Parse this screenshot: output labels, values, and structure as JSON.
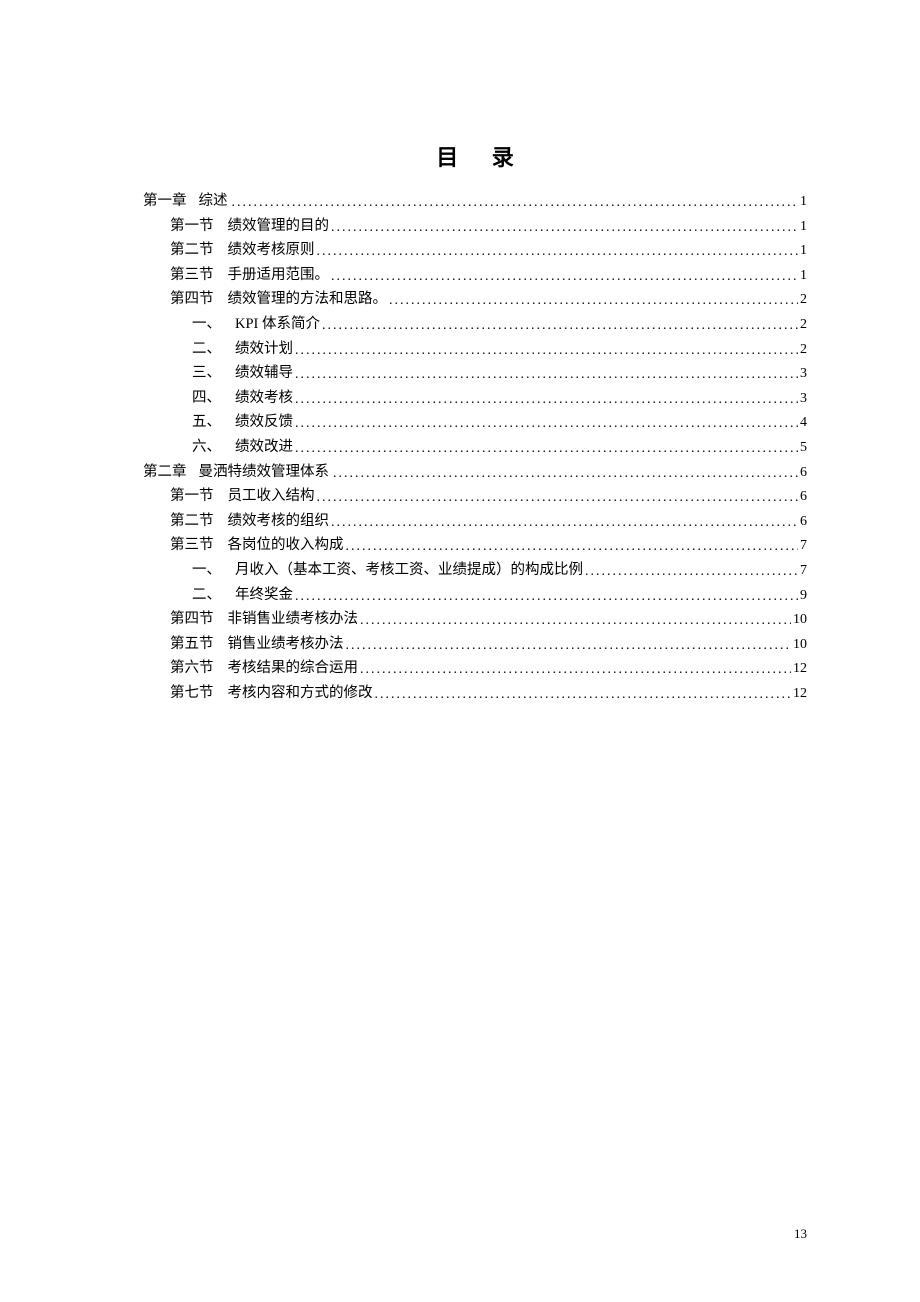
{
  "title": "目 录",
  "page_number": "13",
  "entries": [
    {
      "level": 1,
      "label": "第一章",
      "text": "综述",
      "page": "1",
      "sep": ""
    },
    {
      "level": 2,
      "label": "第一节",
      "text": "绩效管理的目的",
      "page": "1",
      "sep": "gap"
    },
    {
      "level": 2,
      "label": "第二节",
      "text": "绩效考核原则",
      "page": "1",
      "sep": "gap"
    },
    {
      "level": 2,
      "label": "第三节",
      "text": "手册适用范围。",
      "page": "1",
      "sep": "gap"
    },
    {
      "level": 2,
      "label": "第四节",
      "text": "绩效管理的方法和思路。",
      "page": "2",
      "sep": "gap"
    },
    {
      "level": 3,
      "label": "一、",
      "text": "KPI 体系简介",
      "page": "2",
      "sep": "gap"
    },
    {
      "level": 3,
      "label": "二、",
      "text": "绩效计划",
      "page": "2",
      "sep": "gap"
    },
    {
      "level": 3,
      "label": "三、",
      "text": "绩效辅导",
      "page": "3",
      "sep": "gap"
    },
    {
      "level": 3,
      "label": "四、",
      "text": "绩效考核",
      "page": "3",
      "sep": "gap"
    },
    {
      "level": 3,
      "label": "五、",
      "text": "绩效反馈",
      "page": "4",
      "sep": "gap"
    },
    {
      "level": 3,
      "label": "六、",
      "text": "绩效改进",
      "page": "5",
      "sep": "gap"
    },
    {
      "level": 1,
      "label": "第二章",
      "text": "曼洒特绩效管理体系",
      "page": "6",
      "sep": ""
    },
    {
      "level": 2,
      "label": "第一节",
      "text": "员工收入结构",
      "page": "6",
      "sep": "gap"
    },
    {
      "level": 2,
      "label": "第二节",
      "text": "绩效考核的组织",
      "page": "6",
      "sep": "gap"
    },
    {
      "level": 2,
      "label": "第三节",
      "text": "各岗位的收入构成",
      "page": "7",
      "sep": "gap"
    },
    {
      "level": 3,
      "label": "一、",
      "text": "月收入（基本工资、考核工资、业绩提成）的构成比例",
      "page": "7",
      "sep": "gap"
    },
    {
      "level": 3,
      "label": "二、",
      "text": "年终奖金",
      "page": "9",
      "sep": "gap"
    },
    {
      "level": 2,
      "label": "第四节",
      "text": "非销售业绩考核办法",
      "page": "10",
      "sep": "gap"
    },
    {
      "level": 2,
      "label": "第五节",
      "text": "销售业绩考核办法",
      "page": "10",
      "sep": "gap"
    },
    {
      "level": 2,
      "label": "第六节",
      "text": "考核结果的综合运用",
      "page": "12",
      "sep": "gap"
    },
    {
      "level": 2,
      "label": "第七节",
      "text": "考核内容和方式的修改",
      "page": "12",
      "sep": "gap"
    }
  ]
}
